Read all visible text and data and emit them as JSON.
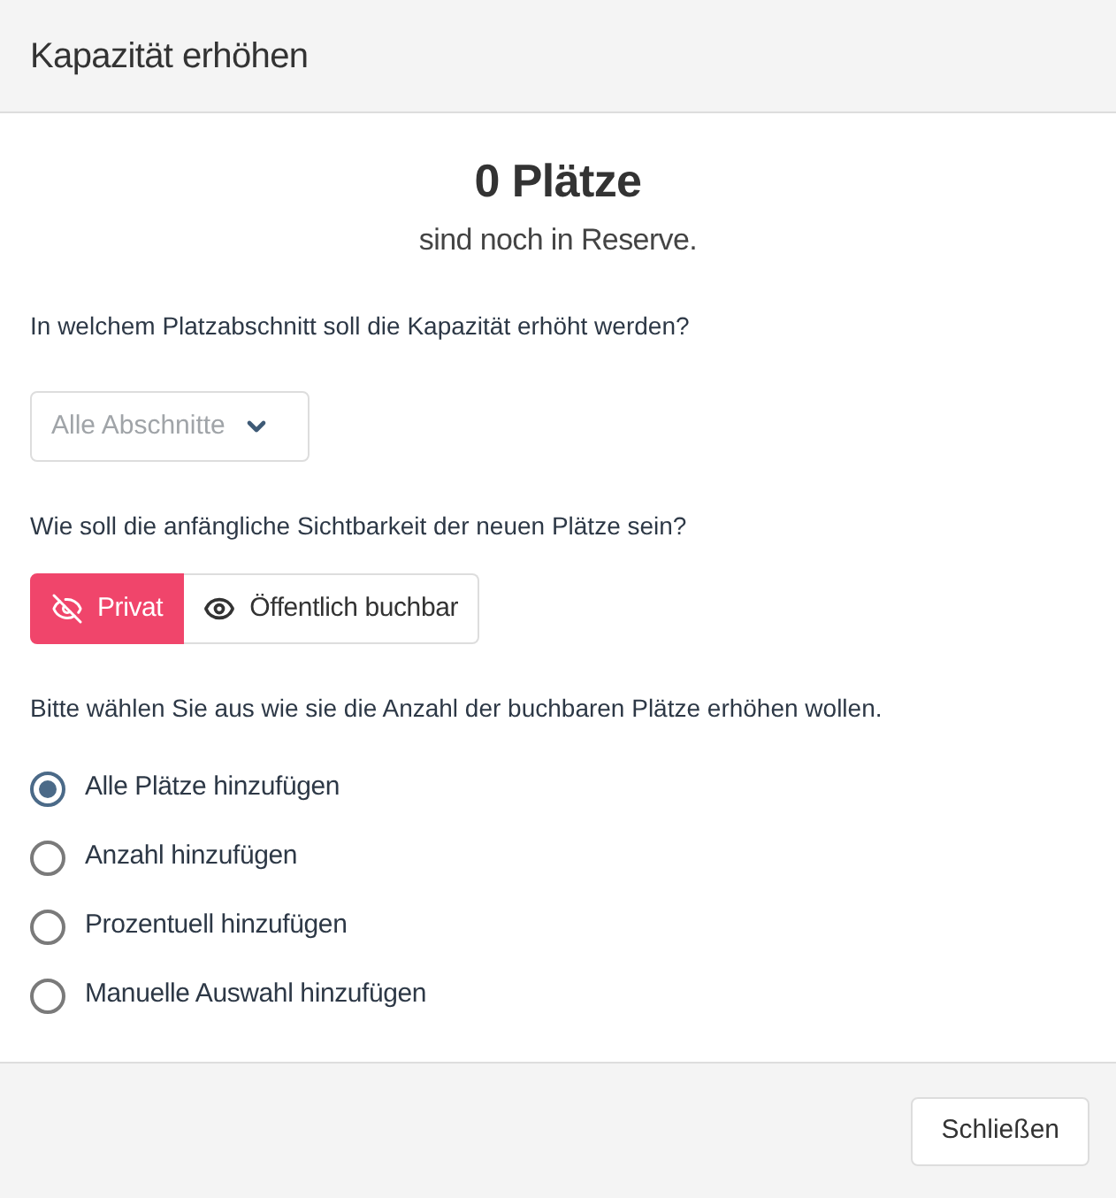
{
  "dialog": {
    "title": "Kapazität erhöhen"
  },
  "reserve": {
    "count": "0 Plätze",
    "caption": "sind noch in Reserve."
  },
  "section_question": "In welchem Platzabschnitt soll die Kapazität erhöht werden?",
  "section_select": {
    "placeholder": "Alle Abschnitte"
  },
  "visibility_question": "Wie soll die anfängliche Sichtbarkeit der neuen Plätze sein?",
  "visibility_options": [
    {
      "label": "Privat",
      "kind": "private",
      "selected": true
    },
    {
      "label": "Öffentlich buchbar",
      "kind": "public",
      "selected": false
    }
  ],
  "method_question": "Bitte wählen Sie aus wie sie die Anzahl der buchbaren Plätze erhöhen wollen.",
  "methods": [
    {
      "label": "Alle Plätze hinzufügen",
      "selected": true
    },
    {
      "label": "Anzahl hinzufügen",
      "selected": false
    },
    {
      "label": "Prozentuell hinzufügen",
      "selected": false
    },
    {
      "label": "Manuelle Auswahl hinzufügen",
      "selected": false
    }
  ],
  "footer": {
    "buttons": [
      "Schließen"
    ]
  }
}
